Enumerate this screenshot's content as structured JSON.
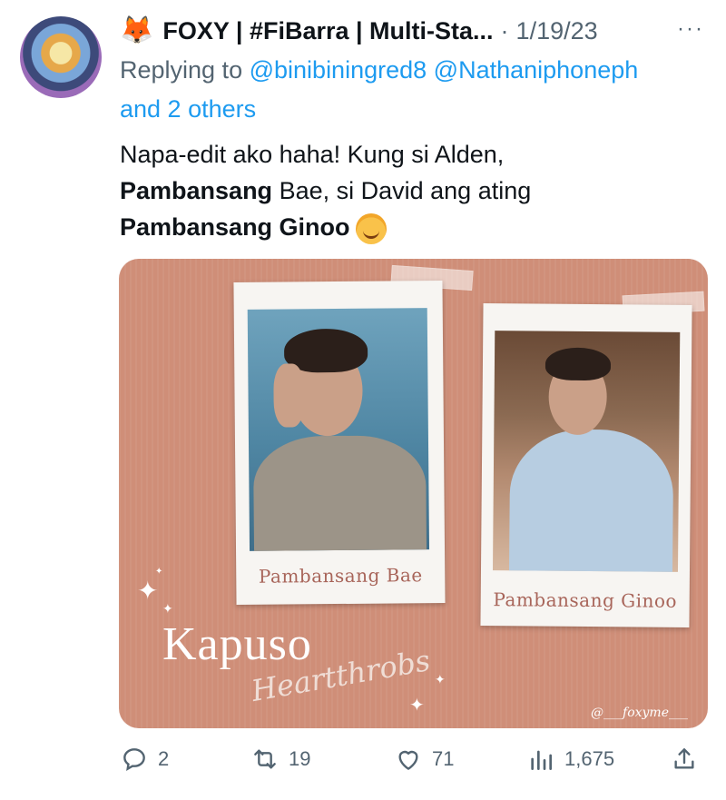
{
  "tweet": {
    "display_name": "FOXY | #FiBarra | Multi-Sta...",
    "separator": "·",
    "date": "1/19/23",
    "more": "···",
    "replying_to_prefix": "Replying to",
    "mention1": "@binibiningred8",
    "mention2": "@Nathaniphoneph",
    "mention_suffix": "and 2 others",
    "text": {
      "line1": "Napa-edit ako haha! Kung si Alden,",
      "line2_bold": "Pambansang",
      "line2_rest": " Bae, si David ang ating",
      "line3_bold": "Pambansang Ginoo"
    },
    "media": {
      "caption_left": "Pambansang Bae",
      "caption_right": "Pambansang Ginoo",
      "title": "Kapuso",
      "subtitle": "Heartthrobs",
      "watermark": "@___foxyme___"
    },
    "actions": {
      "replies": "2",
      "retweets": "19",
      "likes": "71",
      "views": "1,675"
    }
  },
  "colors": {
    "link": "#1d9bf0",
    "muted": "#536471",
    "media_bg": "#cf8e78"
  },
  "icons": [
    "reply-icon",
    "retweet-icon",
    "like-icon",
    "views-icon",
    "share-icon",
    "fox-emoji",
    "smiling-hearts-emoji"
  ]
}
